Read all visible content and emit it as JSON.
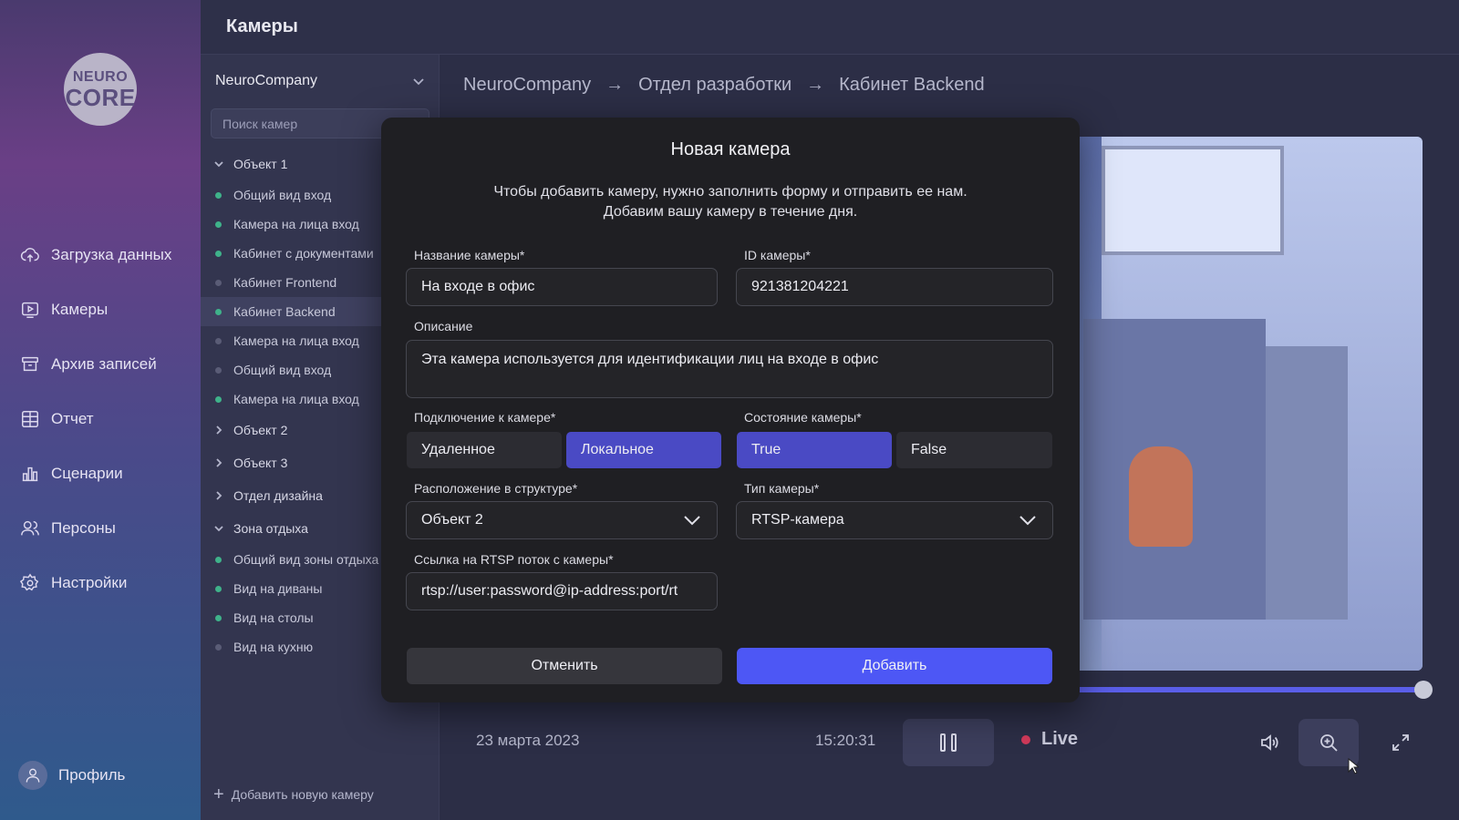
{
  "logo": {
    "line1": "NEURO",
    "line2": "CORE"
  },
  "header": {
    "title": "Камеры"
  },
  "nav": {
    "items": [
      {
        "label": "Загрузка данных",
        "icon": "cloud-upload-icon"
      },
      {
        "label": "Камеры",
        "icon": "camera-play-icon"
      },
      {
        "label": "Архив записей",
        "icon": "archive-icon"
      },
      {
        "label": "Отчет",
        "icon": "table-icon"
      },
      {
        "label": "Сценарии",
        "icon": "bar-chart-icon"
      },
      {
        "label": "Персоны",
        "icon": "people-icon"
      },
      {
        "label": "Настройки",
        "icon": "gear-icon"
      }
    ],
    "profile": "Профиль"
  },
  "camlist": {
    "company": "NeuroCompany",
    "search_placeholder": "Поиск камер",
    "groups": [
      {
        "label": "Объект 1",
        "expanded": true,
        "cameras": [
          {
            "label": "Общий вид вход",
            "status": "online"
          },
          {
            "label": "Камера на лица вход",
            "status": "online"
          },
          {
            "label": "Кабинет с документами",
            "status": "online"
          },
          {
            "label": "Кабинет Frontend",
            "status": "offline"
          },
          {
            "label": "Кабинет Backend",
            "status": "online",
            "active": true
          },
          {
            "label": "Камера на лица вход",
            "status": "offline"
          },
          {
            "label": "Общий вид вход",
            "status": "offline"
          },
          {
            "label": "Камера на лица вход",
            "status": "online"
          }
        ]
      },
      {
        "label": "Объект 2",
        "expanded": false
      },
      {
        "label": "Объект 3",
        "expanded": false
      },
      {
        "label": "Отдел дизайна",
        "expanded": false
      },
      {
        "label": "Зона отдыха",
        "expanded": true,
        "cameras": [
          {
            "label": "Общий вид зоны отдыха",
            "status": "online"
          },
          {
            "label": "Вид на диваны",
            "status": "online"
          },
          {
            "label": "Вид на столы",
            "status": "online"
          },
          {
            "label": "Вид на кухню",
            "status": "offline"
          }
        ]
      }
    ],
    "add_camera": "Добавить новую камеру"
  },
  "breadcrumb": [
    "NeuroCompany",
    "Отдел разработки",
    "Кабинет Backend"
  ],
  "player": {
    "date": "23 марта 2023",
    "time": "15:20:31",
    "live": "Live"
  },
  "modal": {
    "title": "Новая камера",
    "description": "Чтобы добавить камеру, нужно заполнить форму и отправить ее нам. Добавим вашу камеру в течение дня.",
    "name_label": "Название камеры*",
    "name_value": "На входе в офис",
    "id_label": "ID камеры*",
    "id_value": "921381204221",
    "desc_label": "Описание",
    "desc_value": "Эта камера используется для идентификации лиц на входе в офис",
    "connection_label": "Подключение к камере*",
    "connection_options": [
      "Удаленное",
      "Локальное"
    ],
    "connection_selected": "Локальное",
    "state_label": "Состояние камеры*",
    "state_options": [
      "True",
      "False"
    ],
    "state_selected": "True",
    "location_label": "Расположение в структуре*",
    "location_value": "Объект 2",
    "type_label": "Тип камеры*",
    "type_value": "RTSP-камера",
    "rtsp_label": "Ссылка на RTSP поток с камеры*",
    "rtsp_value": "rtsp://user:password@ip-address:port/rt",
    "cancel": "Отменить",
    "submit": "Добавить"
  }
}
